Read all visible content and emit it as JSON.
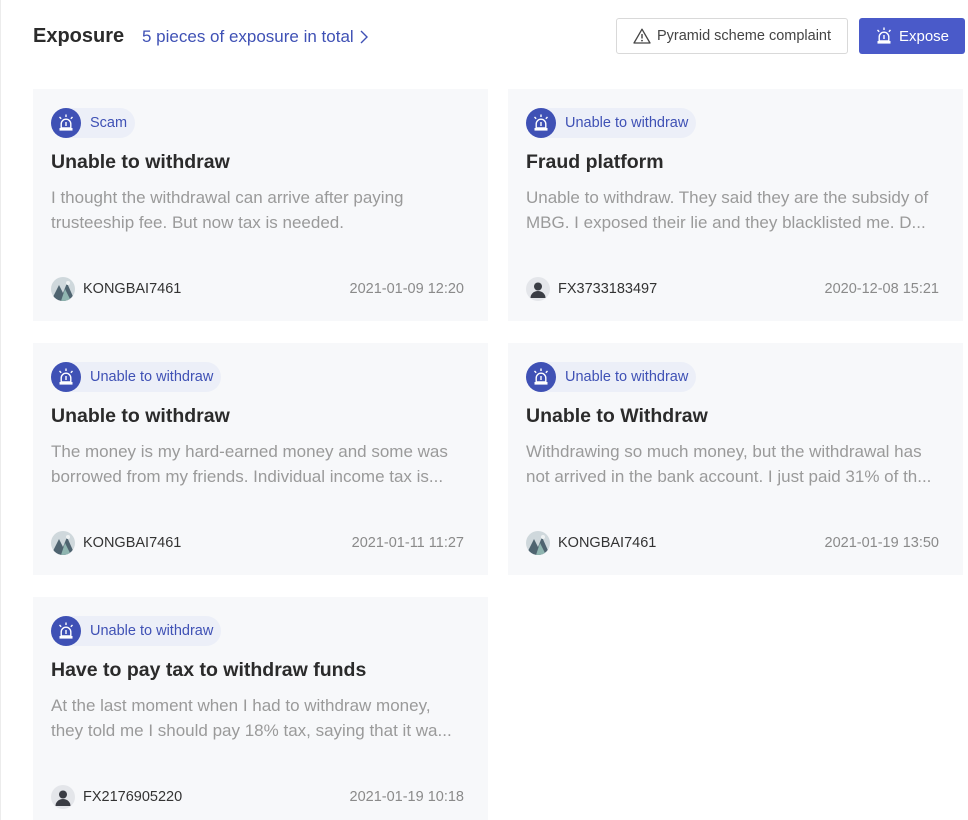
{
  "header": {
    "title": "Exposure",
    "total_link": "5 pieces of exposure in total",
    "complaint_button": "Pyramid scheme complaint",
    "expose_button": "Expose"
  },
  "cards": [
    {
      "tag": "Scam",
      "title": "Unable to withdraw",
      "description": "I thought the withdrawal can arrive after paying trusteeship fee. But now tax is needed.",
      "user": "KONGBAI7461",
      "avatar": "photo-avatar",
      "time": "2021-01-09 12:20"
    },
    {
      "tag": "Unable to withdraw",
      "title": "Fraud platform",
      "description": "Unable to withdraw. They said they are the subsidy of MBG. I exposed their lie and they blacklisted me. D...",
      "user": "FX3733183497",
      "avatar": "default-user-avatar",
      "time": "2020-12-08 15:21"
    },
    {
      "tag": "Unable to withdraw",
      "title": "Unable to withdraw",
      "description": "The money is my hard-earned money and some was borrowed from my friends. Individual income tax is...",
      "user": "KONGBAI7461",
      "avatar": "photo-avatar",
      "time": "2021-01-11 11:27"
    },
    {
      "tag": "Unable to withdraw",
      "title": "Unable to Withdraw",
      "description": "Withdrawing so much money, but the withdrawal has not arrived in the bank account. I just paid 31% of th...",
      "user": "KONGBAI7461",
      "avatar": "photo-avatar",
      "time": "2021-01-19 13:50"
    },
    {
      "tag": "Unable to withdraw",
      "title": "Have to pay tax to withdraw funds",
      "description": "At the last moment when I had to withdraw money, they told me I should pay 18% tax, saying that it wa...",
      "user": "FX2176905220",
      "avatar": "default-user-avatar",
      "time": "2021-01-19 10:18"
    }
  ],
  "icons": {
    "tag_badge": "alarm-siren-icon",
    "complaint": "warning-triangle-icon",
    "expose": "alarm-siren-icon",
    "total_link": "chevron-right-icon"
  },
  "colors": {
    "accent": "#3f51b5",
    "button_primary": "#4a5ac9",
    "card_background": "#f7f8fa",
    "tag_background": "#eceff8",
    "muted_text": "#9a9a9a"
  }
}
